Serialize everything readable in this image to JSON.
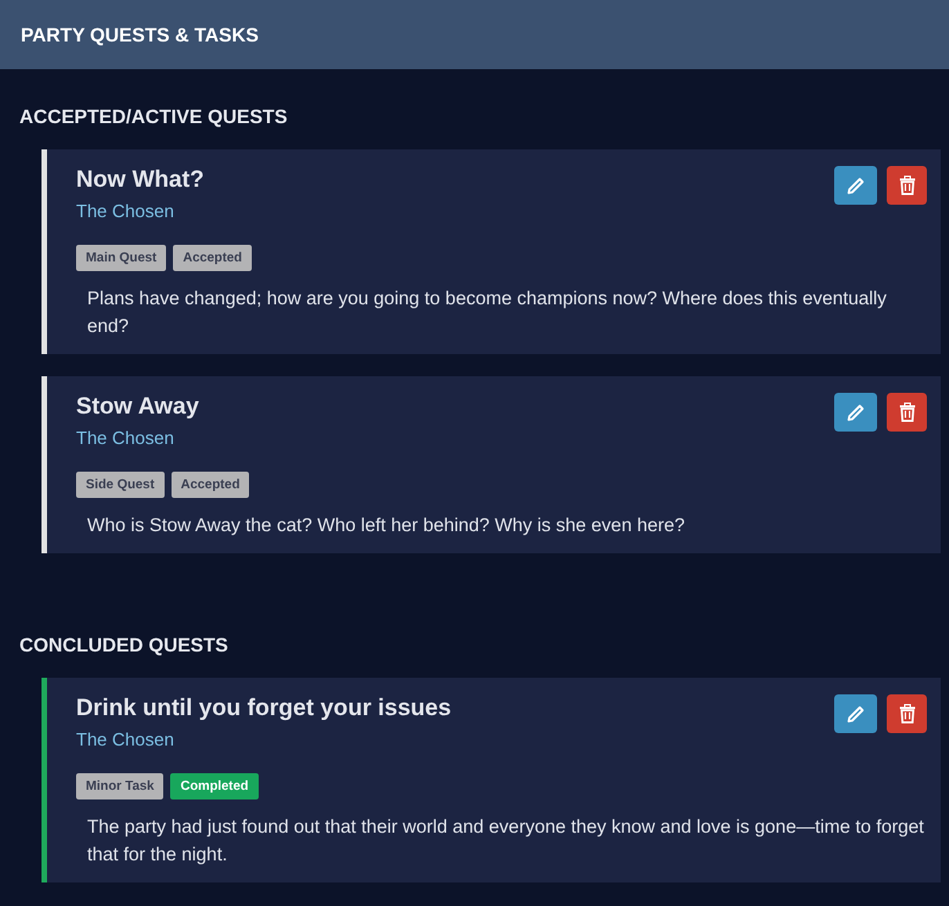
{
  "header": {
    "title": "PARTY QUESTS & TASKS"
  },
  "sections": [
    {
      "heading": "ACCEPTED/ACTIVE QUESTS",
      "quests": [
        {
          "title": "Now What?",
          "party": "The Chosen",
          "type": "Main Quest",
          "status": "Accepted",
          "kind": "accepted",
          "description": "Plans have changed; how are you going to become champions now? Where does this eventually end?"
        },
        {
          "title": "Stow Away",
          "party": "The Chosen",
          "type": "Side Quest",
          "status": "Accepted",
          "kind": "accepted",
          "description": "Who is Stow Away the cat? Who left her behind? Why is she even here?"
        }
      ]
    },
    {
      "heading": "CONCLUDED QUESTS",
      "quests": [
        {
          "title": "Drink until you forget your issues",
          "party": "The Chosen",
          "type": "Minor Task",
          "status": "Completed",
          "kind": "completed",
          "description": "The party had just found out that their world and everyone they know and love is gone—time to forget that for the night."
        }
      ]
    }
  ]
}
